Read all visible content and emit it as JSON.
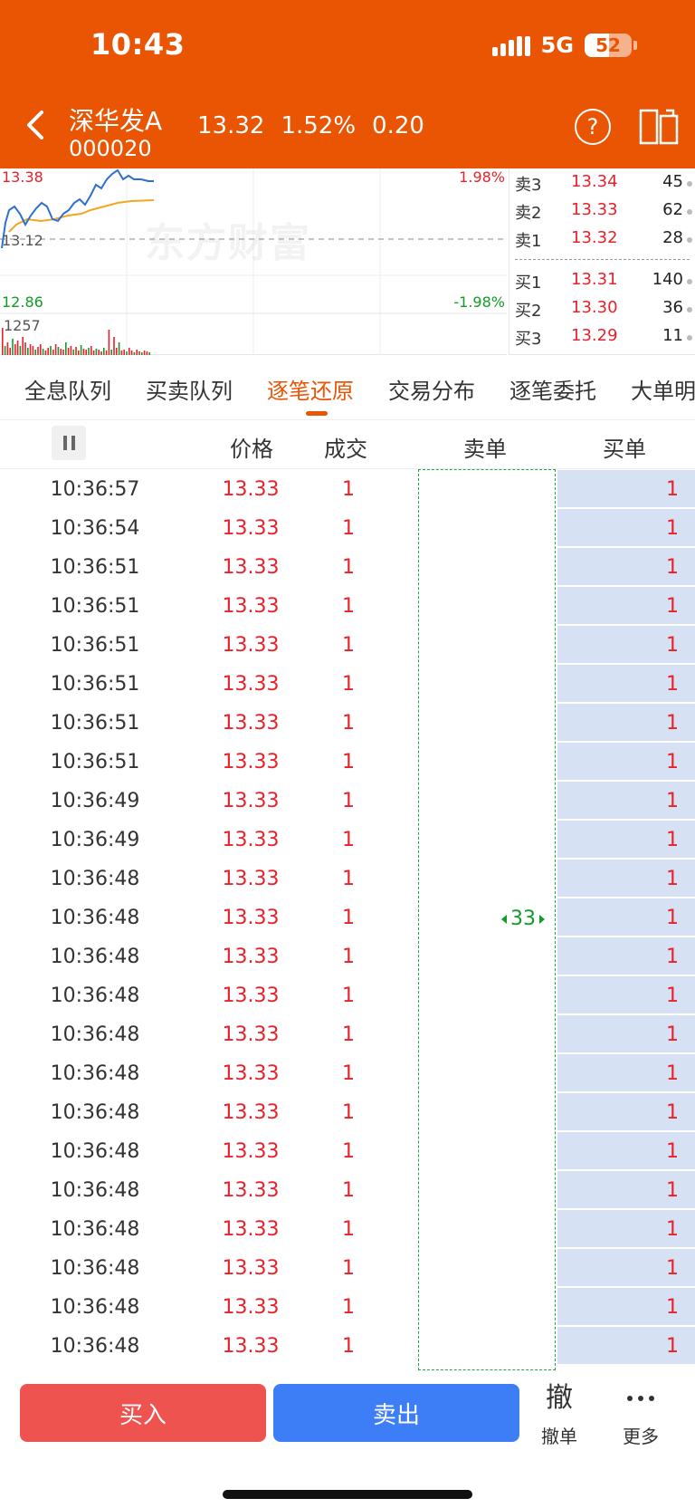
{
  "status": {
    "time": "10:43",
    "network": "5G",
    "battery": "52",
    "battery_fraction": 0.52
  },
  "header": {
    "stock_name": "深华发A",
    "stock_code": "000020",
    "price": "13.32",
    "change_pct": "1.52%",
    "change": "0.20"
  },
  "chart": {
    "high": "13.38",
    "high_pct": "1.98%",
    "mid": "13.12",
    "low": "12.86",
    "low_pct": "-1.98%",
    "vol_label": "1257",
    "watermark": "东方财富",
    "colors": {
      "price_line": "#2f6fd0",
      "avg_line": "#f4a623",
      "up": "#e8212b",
      "down": "#119b27"
    }
  },
  "orderbook": {
    "asks": [
      {
        "label": "卖3",
        "price": "13.34",
        "vol": "45"
      },
      {
        "label": "卖2",
        "price": "13.33",
        "vol": "62"
      },
      {
        "label": "卖1",
        "price": "13.32",
        "vol": "28"
      }
    ],
    "bids": [
      {
        "label": "买1",
        "price": "13.31",
        "vol": "140"
      },
      {
        "label": "买2",
        "price": "13.30",
        "vol": "36"
      },
      {
        "label": "买3",
        "price": "13.29",
        "vol": "11"
      }
    ]
  },
  "tabs": [
    "全息队列",
    "买卖队列",
    "逐笔还原",
    "交易分布",
    "逐笔委托",
    "大单明细"
  ],
  "active_tab": 2,
  "table": {
    "headers": {
      "price": "价格",
      "volume": "成交",
      "sell": "卖单",
      "buy": "买单"
    },
    "sell_count": "33",
    "rows": [
      {
        "time": "10:36:57",
        "price": "13.33",
        "vol": "1",
        "buy": "1"
      },
      {
        "time": "10:36:54",
        "price": "13.33",
        "vol": "1",
        "buy": "1"
      },
      {
        "time": "10:36:51",
        "price": "13.33",
        "vol": "1",
        "buy": "1"
      },
      {
        "time": "10:36:51",
        "price": "13.33",
        "vol": "1",
        "buy": "1"
      },
      {
        "time": "10:36:51",
        "price": "13.33",
        "vol": "1",
        "buy": "1"
      },
      {
        "time": "10:36:51",
        "price": "13.33",
        "vol": "1",
        "buy": "1"
      },
      {
        "time": "10:36:51",
        "price": "13.33",
        "vol": "1",
        "buy": "1"
      },
      {
        "time": "10:36:51",
        "price": "13.33",
        "vol": "1",
        "buy": "1"
      },
      {
        "time": "10:36:49",
        "price": "13.33",
        "vol": "1",
        "buy": "1"
      },
      {
        "time": "10:36:49",
        "price": "13.33",
        "vol": "1",
        "buy": "1"
      },
      {
        "time": "10:36:48",
        "price": "13.33",
        "vol": "1",
        "buy": "1"
      },
      {
        "time": "10:36:48",
        "price": "13.33",
        "vol": "1",
        "buy": "1"
      },
      {
        "time": "10:36:48",
        "price": "13.33",
        "vol": "1",
        "buy": "1"
      },
      {
        "time": "10:36:48",
        "price": "13.33",
        "vol": "1",
        "buy": "1"
      },
      {
        "time": "10:36:48",
        "price": "13.33",
        "vol": "1",
        "buy": "1"
      },
      {
        "time": "10:36:48",
        "price": "13.33",
        "vol": "1",
        "buy": "1"
      },
      {
        "time": "10:36:48",
        "price": "13.33",
        "vol": "1",
        "buy": "1"
      },
      {
        "time": "10:36:48",
        "price": "13.33",
        "vol": "1",
        "buy": "1"
      },
      {
        "time": "10:36:48",
        "price": "13.33",
        "vol": "1",
        "buy": "1"
      },
      {
        "time": "10:36:48",
        "price": "13.33",
        "vol": "1",
        "buy": "1"
      },
      {
        "time": "10:36:48",
        "price": "13.33",
        "vol": "1",
        "buy": "1"
      },
      {
        "time": "10:36:48",
        "price": "13.33",
        "vol": "1",
        "buy": "1"
      },
      {
        "time": "10:36:48",
        "price": "13.33",
        "vol": "1",
        "buy": "1"
      }
    ]
  },
  "bottom": {
    "buy_label": "买入",
    "sell_label": "卖出",
    "cancel_icon": "撤",
    "cancel_label": "撤单",
    "more_label": "更多"
  }
}
